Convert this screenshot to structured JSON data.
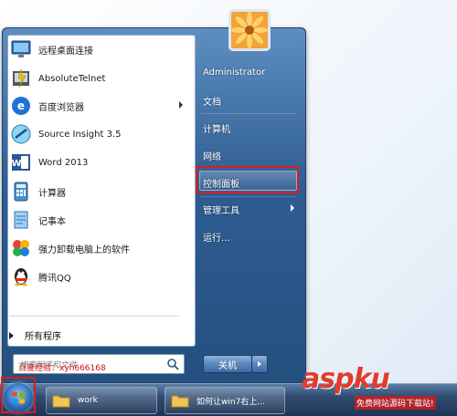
{
  "programs": [
    {
      "label": "远程桌面连接",
      "icon": "remote-desktop-icon",
      "has_submenu": false
    },
    {
      "label": "AbsoluteTelnet",
      "icon": "absolute-telnet-icon",
      "has_submenu": false
    },
    {
      "label": "百度浏览器",
      "icon": "baidu-browser-icon",
      "has_submenu": true
    },
    {
      "label": "Source Insight 3.5",
      "icon": "source-insight-icon",
      "has_submenu": false
    },
    {
      "label": "Word 2013",
      "icon": "word-icon",
      "has_submenu": false
    },
    {
      "label": "计算器",
      "icon": "calculator-icon",
      "has_submenu": false
    },
    {
      "label": "记事本",
      "icon": "notepad-icon",
      "has_submenu": false
    },
    {
      "label": "强力卸载电脑上的软件",
      "icon": "uninstaller-icon",
      "has_submenu": false
    },
    {
      "label": "腾讯QQ",
      "icon": "qq-icon",
      "has_submenu": false
    }
  ],
  "all_programs": "所有程序",
  "search": {
    "placeholder": "搜索程序和文件"
  },
  "annotation_text": "百度经验：xyh666168",
  "right_panel": {
    "user": "Administrator",
    "documents": "文档",
    "computer": "计算机",
    "network": "网络",
    "control_panel": "控制面板",
    "admin_tools": "管理工具",
    "run": "运行..."
  },
  "shutdown_label": "关机",
  "taskbar": {
    "items": [
      {
        "label": "work"
      },
      {
        "label": "如何让win7右上..."
      }
    ]
  },
  "watermark": {
    "logo": "aspku",
    "sub": "免费网站源码下载站!"
  },
  "colors": {
    "highlight_red": "#d81e1e",
    "menu_blue": "#2f5d93"
  }
}
